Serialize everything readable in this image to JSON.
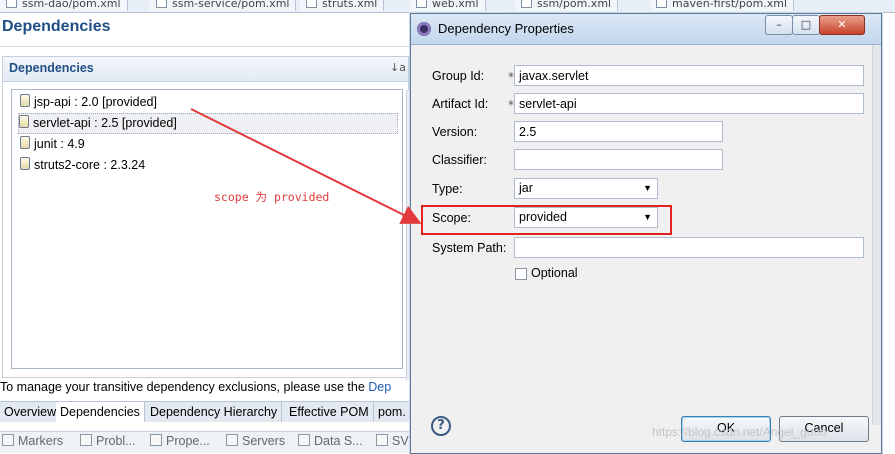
{
  "editor_tabs": [
    {
      "label": "ssm-dao/pom.xml"
    },
    {
      "label": "ssm-service/pom.xml"
    },
    {
      "label": "struts.xml"
    },
    {
      "label": "web.xml"
    },
    {
      "label": "ssm/pom.xml"
    },
    {
      "label": "maven-first/pom.xml"
    }
  ],
  "page": {
    "title": "Dependencies"
  },
  "section": {
    "title": "Dependencies"
  },
  "dependencies": [
    {
      "label": "jsp-api : 2.0 [provided]"
    },
    {
      "label": "servlet-api : 2.5 [provided]"
    },
    {
      "label": "junit : 4.9"
    },
    {
      "label": "struts2-core : 2.3.24"
    }
  ],
  "hint": {
    "text": "To manage your transitive dependency exclusions, please use the ",
    "link": "Dep"
  },
  "pom_tabs": [
    {
      "label": "Overview"
    },
    {
      "label": "Dependencies"
    },
    {
      "label": "Dependency Hierarchy"
    },
    {
      "label": "Effective POM"
    },
    {
      "label": "pom."
    }
  ],
  "views": [
    {
      "label": "Markers"
    },
    {
      "label": "Probl..."
    },
    {
      "label": "Prope..."
    },
    {
      "label": "Servers"
    },
    {
      "label": "Data S..."
    },
    {
      "label": "SV"
    }
  ],
  "annotation": {
    "text": "scope 为 provided",
    "color": "#e23a3a"
  },
  "dialog": {
    "title": "Dependency Properties",
    "fields": {
      "group_id": {
        "label": "Group Id:",
        "value": "javax.servlet"
      },
      "artifact_id": {
        "label": "Artifact Id:",
        "value": "servlet-api"
      },
      "version": {
        "label": "Version:",
        "value": "2.5"
      },
      "classifier": {
        "label": "Classifier:",
        "value": ""
      },
      "type": {
        "label": "Type:",
        "value": "jar"
      },
      "scope": {
        "label": "Scope:",
        "value": "provided"
      },
      "system_path": {
        "label": "System Path:",
        "value": ""
      }
    },
    "optional": {
      "label": "Optional",
      "checked": false
    },
    "required_mark": "*",
    "ok": "OK",
    "cancel": "Cancel",
    "help_glyph": "?",
    "window_buttons": {
      "minimize": "–",
      "maximize": "□",
      "close": "✕"
    }
  },
  "watermark": "https://blog.csdn.net/Angel_guoo",
  "colors": {
    "title_blue": "#1f4f86",
    "highlight_red": "#e2221f",
    "link_blue": "#1e5bb8"
  },
  "icons": [
    "jar-icon",
    "sort-icon",
    "help-icon",
    "eclipse-app-icon",
    "minimize-icon",
    "maximize-icon",
    "close-icon",
    "required-marker-icon",
    "checkbox-icon"
  ]
}
